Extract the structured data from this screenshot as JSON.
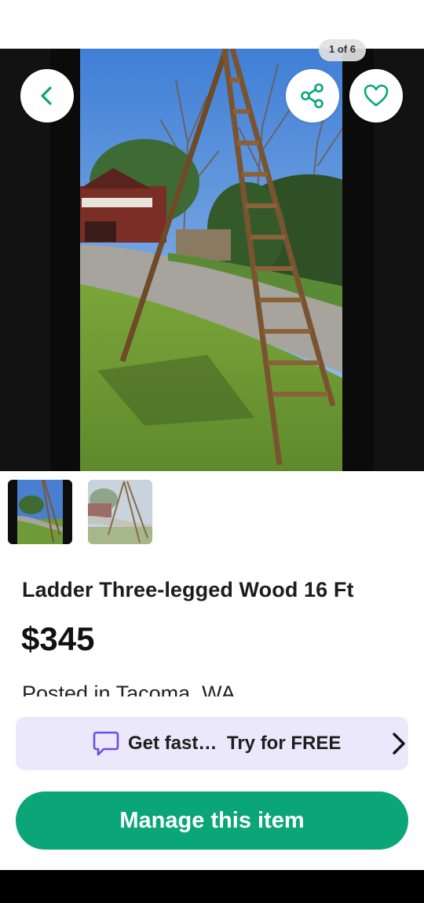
{
  "photo": {
    "counter": "1 of 6"
  },
  "actions": {
    "back_icon": "chevron-left-icon",
    "share_icon": "share-icon",
    "favorite_icon": "heart-icon",
    "accent_color": "#0aa677"
  },
  "thumbnails": [
    {
      "index": 1,
      "active": true
    },
    {
      "index": 2,
      "active": false
    }
  ],
  "listing": {
    "title": "Ladder Three-legged Wood 16 Ft",
    "price": "$345",
    "location": "Posted in Tacoma, WA"
  },
  "promo": {
    "icon": "chat-bubble-icon",
    "text": "Get fast…",
    "cta": "Try for FREE",
    "chevron_icon": "chevron-right-icon",
    "background": "#ece8fb"
  },
  "primary_action": {
    "label": "Manage this item",
    "color": "#0aa677"
  }
}
